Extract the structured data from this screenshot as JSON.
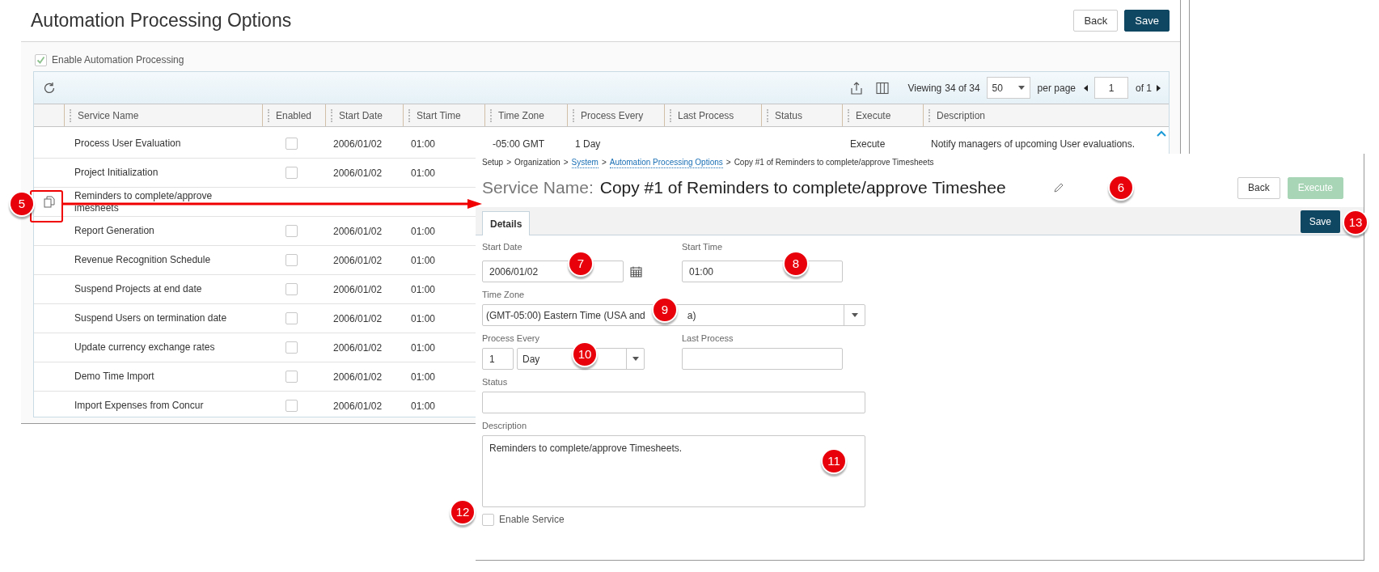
{
  "page": {
    "title": "Automation Processing Options",
    "buttons": [
      {
        "label": "Back",
        "kind": "secondary"
      },
      {
        "label": "Save",
        "kind": "primary"
      }
    ]
  },
  "enable_automation": {
    "label": "Enable Automation Processing",
    "checked": true
  },
  "grid": {
    "viewing_label": "Viewing",
    "viewing_count": "34 of 34",
    "per_page": "50",
    "per_page_label": "per page",
    "page": "1",
    "page_of": "of 1",
    "columns": [
      "Service Name",
      "Enabled",
      "Start Date",
      "Start Time",
      "Time Zone",
      "Process Every",
      "Last Process",
      "Status",
      "Execute",
      "Description"
    ],
    "rows": [
      {
        "service_name": "Process User Evaluation",
        "enabled": false,
        "start_date": "2006/01/02",
        "start_time": "01:00",
        "time_zone": "-05:00 GMT",
        "process_every": "1 Day",
        "execute": "Execute",
        "description": "Notify managers of upcoming User evaluations."
      },
      {
        "service_name": "Project Initialization",
        "enabled": false,
        "start_date": "2006/01/02",
        "start_time": "01:00"
      },
      {
        "service_name": "Reminders to complete/approve imesheets",
        "copy_icon": true
      },
      {
        "service_name": "Report Generation",
        "enabled": false,
        "start_date": "2006/01/02",
        "start_time": "01:00"
      },
      {
        "service_name": "Revenue Recognition Schedule",
        "enabled": false,
        "start_date": "2006/01/02",
        "start_time": "01:00"
      },
      {
        "service_name": "Suspend Projects at end date",
        "enabled": false,
        "start_date": "2006/01/02",
        "start_time": "01:00"
      },
      {
        "service_name": "Suspend Users on termination date",
        "enabled": false,
        "start_date": "2006/01/02",
        "start_time": "01:00"
      },
      {
        "service_name": "Update currency exchange rates",
        "enabled": false,
        "start_date": "2006/01/02",
        "start_time": "01:00"
      },
      {
        "service_name": "Demo Time Import",
        "enabled": false,
        "start_date": "2006/01/02",
        "start_time": "01:00"
      },
      {
        "service_name": "Import Expenses from Concur",
        "enabled": false,
        "start_date": "2006/01/02",
        "start_time": "01:00"
      }
    ]
  },
  "detail_panel": {
    "breadcrumb": {
      "separator": ">",
      "items": [
        {
          "text": "Setup",
          "link": false
        },
        {
          "text": "Organization",
          "link": false
        },
        {
          "text": "System",
          "link": true
        },
        {
          "text": "Automation Processing Options",
          "link": true
        },
        {
          "text": "Copy #1 of Reminders to complete/approve Timesheets",
          "link": false
        }
      ]
    },
    "title_label": "Service Name:",
    "title_value": "Copy #1 of Reminders to complete/approve Timeshee",
    "buttons": [
      {
        "label": "Back",
        "disabled": false
      },
      {
        "label": "Execute",
        "disabled": true
      }
    ],
    "tabs": [
      {
        "label": "Details",
        "selected": true
      }
    ],
    "save": "Save",
    "start_date": {
      "label": "Start Date",
      "value": "2006/01/02"
    },
    "start_time": {
      "label": "Start Time",
      "value": "01:00"
    },
    "time_zone": {
      "label": "Time Zone",
      "value_parts": [
        "(GMT-05:00) Eastern Time (USA and",
        "a)"
      ]
    },
    "process_every": {
      "label": "Process Every",
      "count": "1",
      "unit": "Day"
    },
    "last_process": {
      "label": "Last Process"
    },
    "status": {
      "label": "Status"
    },
    "description": {
      "label": "Description",
      "value": "Reminders to complete/approve Timesheets."
    },
    "enable_service": {
      "label": "Enable Service",
      "checked": false
    }
  },
  "callouts": [
    {
      "number": "5"
    },
    {
      "number": "6"
    },
    {
      "number": "7"
    },
    {
      "number": "8"
    },
    {
      "number": "9"
    },
    {
      "number": "10"
    },
    {
      "number": "11"
    },
    {
      "number": "12"
    },
    {
      "number": "13"
    }
  ]
}
